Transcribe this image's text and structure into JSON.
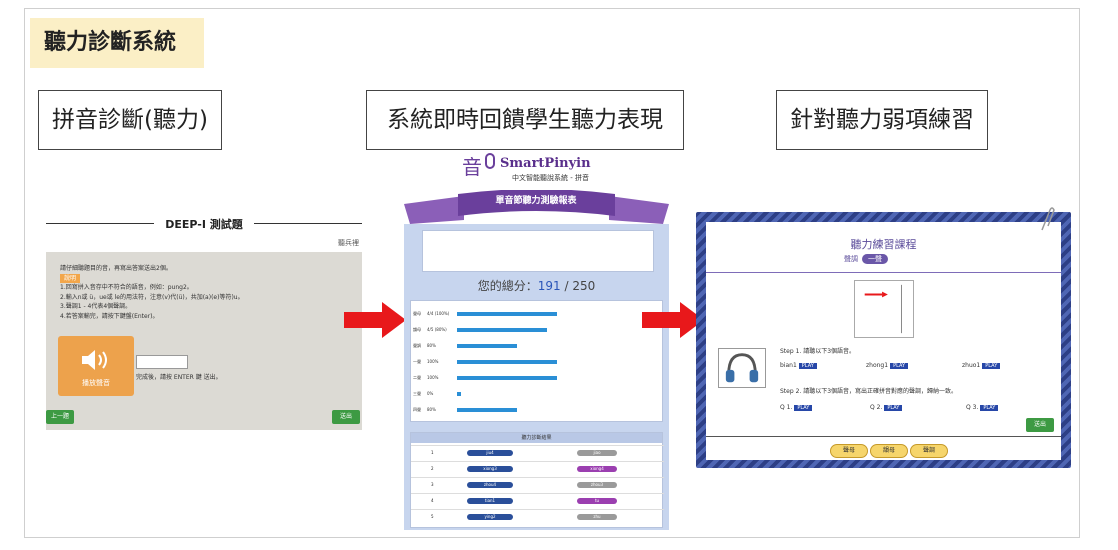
{
  "title": "聽力診斷系統",
  "steps": [
    {
      "label": "拼音診斷(聽力)"
    },
    {
      "label": "系統即時回饋學生聽力表現"
    },
    {
      "label": "針對聽力弱項練習"
    }
  ],
  "panel1": {
    "heading": "DEEP-I 測試題",
    "subheading": "聽兵裡",
    "instructions": [
      "請仔細聽題目的音，再寫出答案送出2個。",
      "1.回寫拼入音存中不符合的語音，例如：pung2。",
      "2.輸入n或 ü，ue或 le的用法符，注意(v)代(ü)，共加(a)(e)等符)u。",
      "3.聲調1 - 4代表4個聲調。",
      "4.若答案輸完，請按下鍵盤(Enter)。"
    ],
    "tag": "說明",
    "audio_label": "播放聲音",
    "hint": "完成後，請按 ENTER 鍵 送出。",
    "left_button": "上一題",
    "right_button": "送出"
  },
  "panel2": {
    "logo_name": "SmartPinyin",
    "logo_sub": "中文智能聽說系統 - 拼音",
    "ribbon": "單音節聽力測驗報表",
    "score_label": "您的總分：",
    "score_value": "191",
    "score_total": "250",
    "list_head": "聽力診斷結果",
    "row_labels": [
      "聲母",
      "韻母",
      "聲調",
      "一聲",
      "二聲",
      "三聲",
      "四聲"
    ],
    "row_pcts": [
      "4/4 (100%)",
      "4/5 (80%)",
      "80%",
      "100%",
      "100%",
      "0%",
      "80%"
    ],
    "list_items": [
      {
        "n": "1",
        "a": "jiu4",
        "b": "jiao"
      },
      {
        "n": "2",
        "a": "xiong3",
        "b": "xiong4"
      },
      {
        "n": "3",
        "a": "zhou4",
        "b": "zhou3"
      },
      {
        "n": "4",
        "a": "tian1",
        "b": "tu"
      },
      {
        "n": "5",
        "a": "ying2",
        "b": "zhu"
      }
    ]
  },
  "panel3": {
    "title": "聽力練習課程",
    "subtitle": "聲調",
    "badge": "一聲",
    "step1": "Step 1. 請聽以下3個語音。",
    "words": [
      "bian1",
      "zhong1",
      "zhuo1"
    ],
    "play": "PLAY",
    "step2": "Step 2. 請聽以下3個語音，寫出正確拼音對應的聲調，歸納一致。",
    "answers": [
      "Q 1.",
      "Q 2.",
      "Q 3."
    ],
    "next": "送出",
    "tabs": [
      "聲母",
      "韻母",
      "聲調"
    ]
  },
  "colors": {
    "banner": "#fbefc6",
    "arrow": "#e8181b",
    "accent_blue": "#2747a8",
    "purple": "#6a57a8"
  }
}
